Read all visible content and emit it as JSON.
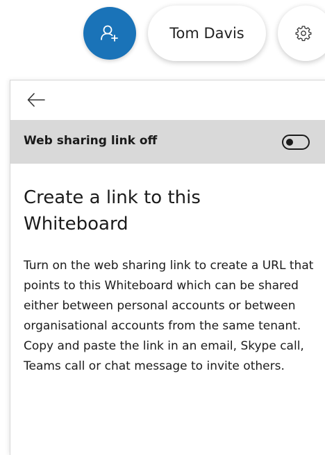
{
  "toolbar": {
    "add_user_icon": "add-person-icon",
    "user_name": "Tom Davis",
    "settings_icon": "gear-icon",
    "accent_color": "#1a73b8"
  },
  "panel": {
    "back_icon": "arrow-left-icon",
    "toggle_label": "Web sharing link off",
    "toggle_state": "off",
    "heading": "Create a link to this Whiteboard",
    "body": "Turn on the web sharing link to create a URL that points to this Whiteboard which can be shared either between personal accounts or between organisational accounts from the same tenant. Copy and paste the link in an email, Skype call, Teams call or chat message to invite others.",
    "toggle_row_color": "#d9d9d9"
  }
}
